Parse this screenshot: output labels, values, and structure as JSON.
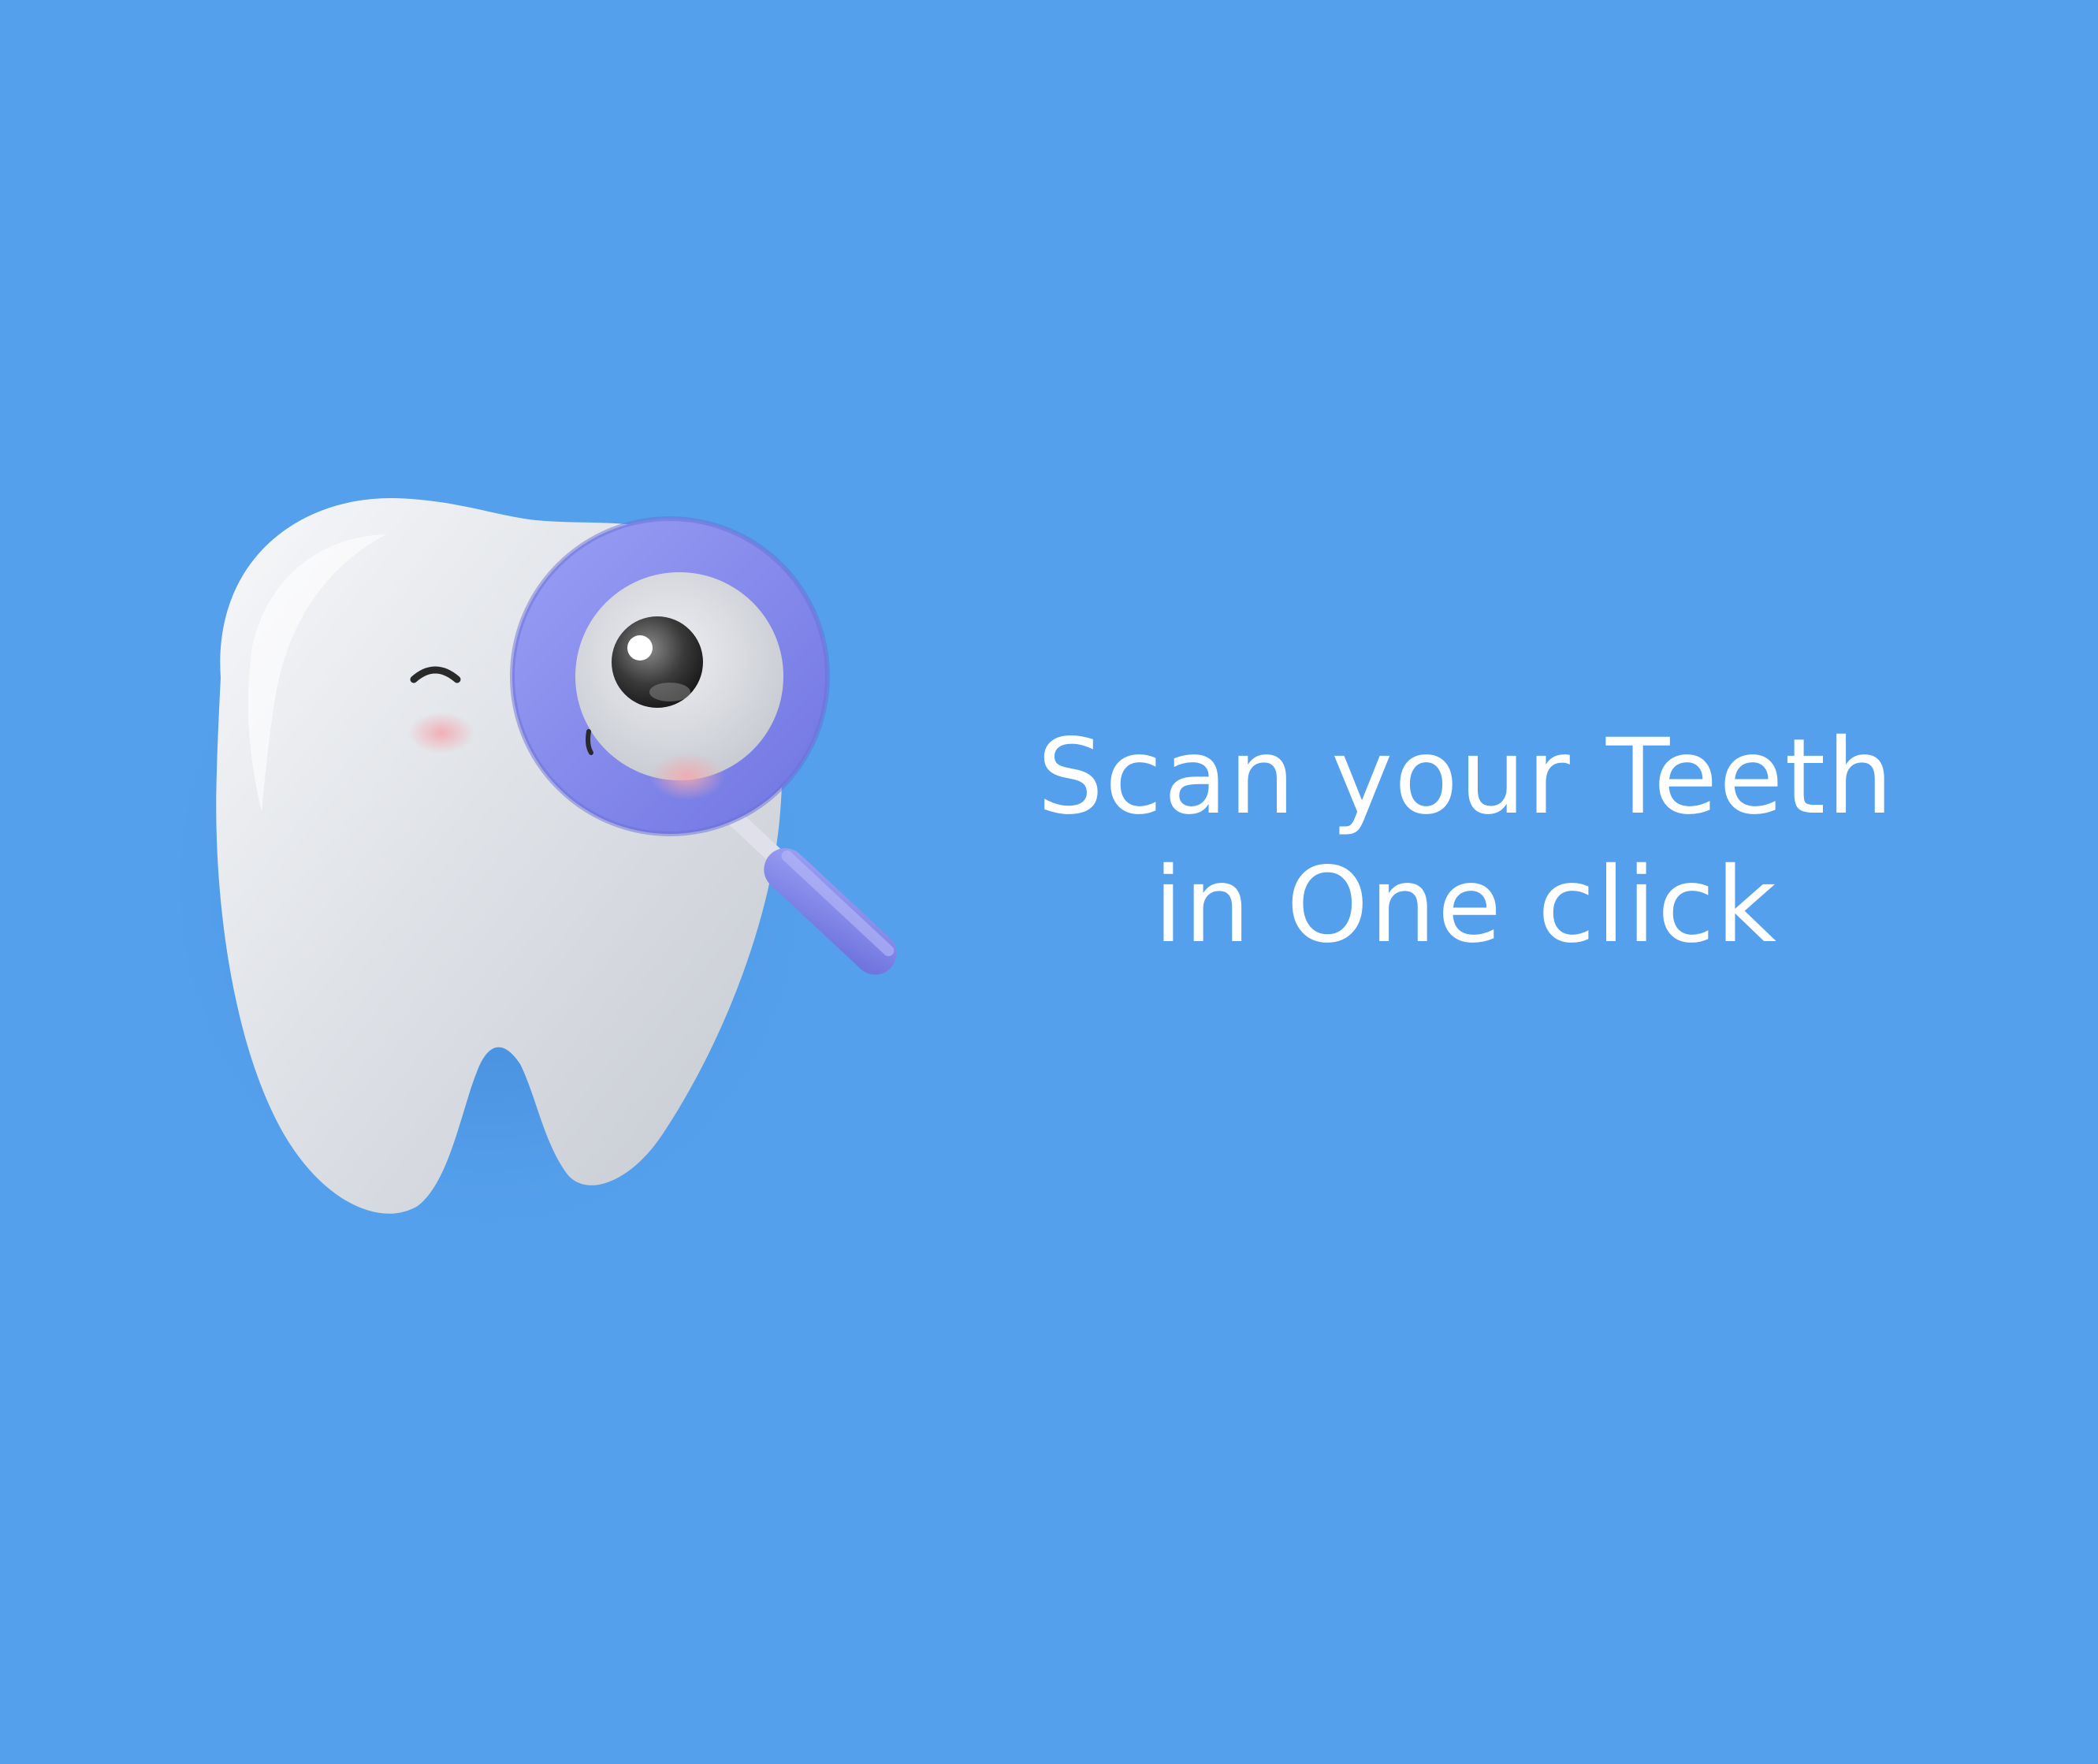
{
  "screen": {
    "background_color": "#55a0ec"
  },
  "mascot": {
    "icon": "tooth-with-magnifier-icon",
    "tooth_color": "#d8dce2",
    "magnifier_color": "#8a8ef0"
  },
  "headline": {
    "line1": "Scan your Teeth",
    "line2": "in One click",
    "color": "#ffffff"
  }
}
